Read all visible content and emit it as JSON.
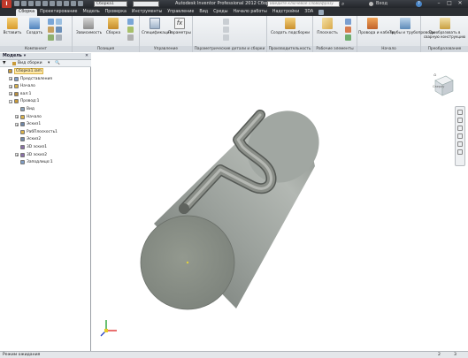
{
  "window": {
    "app_title": "Autodesk Inventor Professional 2012   Сборка1",
    "document_selector": "Сборка1",
    "search_placeholder": "Введите ключевое слово/фразу",
    "signin": "Вход",
    "controls": [
      "–",
      "□",
      "✕"
    ]
  },
  "tabs": [
    {
      "label": "Сборка",
      "active": true
    },
    {
      "label": "Проектирование",
      "active": false
    },
    {
      "label": "Модель",
      "active": false
    },
    {
      "label": "Проверка",
      "active": false
    },
    {
      "label": "Инструменты",
      "active": false
    },
    {
      "label": "Управление",
      "active": false
    },
    {
      "label": "Вид",
      "active": false
    },
    {
      "label": "Среды",
      "active": false
    },
    {
      "label": "Начало работы",
      "active": false
    },
    {
      "label": "Надстройки",
      "active": false
    },
    {
      "label": "3DA",
      "active": false
    }
  ],
  "ribbon": {
    "buttons": {
      "insert": "Вставить",
      "create": "Создать",
      "constraints": "Зависимость",
      "assemble": "Сборка",
      "bom": "Спецификация",
      "parameters": "Параметры",
      "create_subassembly": "Создать подсборки",
      "plane": "Плоскость",
      "wires_cables": "Провода и кабели",
      "tubes_pipes": "Трубы и трубопроводы",
      "convert_welded": "Преобразовать в сварную конструкцию"
    },
    "panels": {
      "component": "Компонент",
      "position": "Позиция",
      "manage": "Управление",
      "parametric": "Параметрические детали и сборки",
      "productivity": "Производительность",
      "work_features": "Рабочие элементы",
      "begin": "Начало",
      "convert": "Преобразование"
    }
  },
  "browser": {
    "title": "Модель",
    "view_label": "Вид сборки",
    "tree": [
      {
        "label": "Сборка1.iam",
        "level": 0,
        "expander": "",
        "selected": true
      },
      {
        "label": "Представления",
        "level": 1,
        "expander": "+"
      },
      {
        "label": "Начало",
        "level": 1,
        "expander": "+"
      },
      {
        "label": "вал:1",
        "level": 1,
        "expander": "+"
      },
      {
        "label": "Провод:1",
        "level": 1,
        "expander": "−"
      },
      {
        "label": "Вид",
        "level": 2,
        "expander": ""
      },
      {
        "label": "Начало",
        "level": 2,
        "expander": "+"
      },
      {
        "label": "Эскиз1",
        "level": 2,
        "expander": "+"
      },
      {
        "label": "РабПлоскость1",
        "level": 2,
        "expander": ""
      },
      {
        "label": "Эскиз2",
        "level": 2,
        "expander": ""
      },
      {
        "label": "3D эскиз1",
        "level": 2,
        "expander": ""
      },
      {
        "label": "3D эскиз2",
        "level": 2,
        "expander": "+"
      },
      {
        "label": "Заподлицо:1",
        "level": 2,
        "expander": ""
      }
    ]
  },
  "viewcube": {
    "face": "Сверху"
  },
  "status": {
    "text": "Режим ожидания",
    "count_a": "2",
    "count_b": "3"
  },
  "colors": {
    "accent": "#2b5797",
    "model_gray": "#8e9591",
    "tube_gray": "#7c8079"
  }
}
